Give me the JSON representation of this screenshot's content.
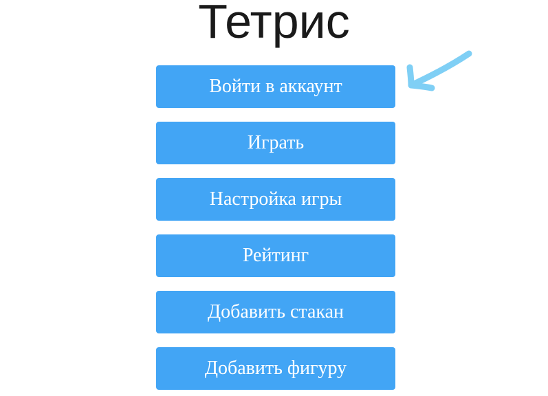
{
  "title": "Тетрис",
  "menu": {
    "items": [
      {
        "label": "Войти в аккаунт"
      },
      {
        "label": "Играть"
      },
      {
        "label": "Настройка игры"
      },
      {
        "label": "Рейтинг"
      },
      {
        "label": "Добавить стакан"
      },
      {
        "label": "Добавить фигуру"
      }
    ]
  },
  "colors": {
    "button_bg": "#42a5f5",
    "button_text": "#ffffff",
    "title_text": "#1a1a1a",
    "annotation_arrow": "#7fcff5"
  },
  "annotation": {
    "icon": "arrow-pointing-left-icon"
  }
}
